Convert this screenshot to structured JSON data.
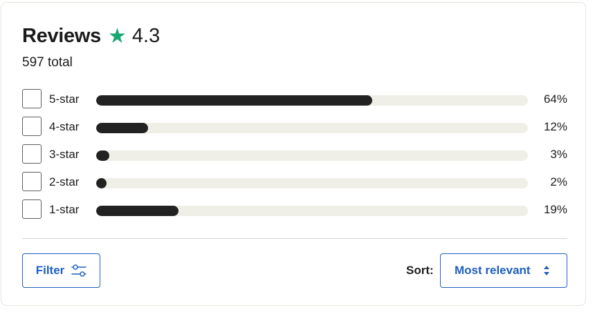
{
  "reviews": {
    "title": "Reviews",
    "rating": "4.3",
    "total": "597 total",
    "accent": "#1aa872"
  },
  "breakdown": [
    {
      "label": "5-star",
      "percent_label": "64%",
      "fraction": 0.64
    },
    {
      "label": "4-star",
      "percent_label": "12%",
      "fraction": 0.12
    },
    {
      "label": "3-star",
      "percent_label": "3%",
      "fraction": 0.03
    },
    {
      "label": "2-star",
      "percent_label": "2%",
      "fraction": 0.02
    },
    {
      "label": "1-star",
      "percent_label": "19%",
      "fraction": 0.19
    }
  ],
  "controls": {
    "filter_label": "Filter",
    "filter_icon": "sliders-icon",
    "sort_label": "Sort:",
    "sort_value": "Most relevant",
    "sort_icon": "up-down-arrows-icon",
    "link_color": "#1f5fbf"
  }
}
